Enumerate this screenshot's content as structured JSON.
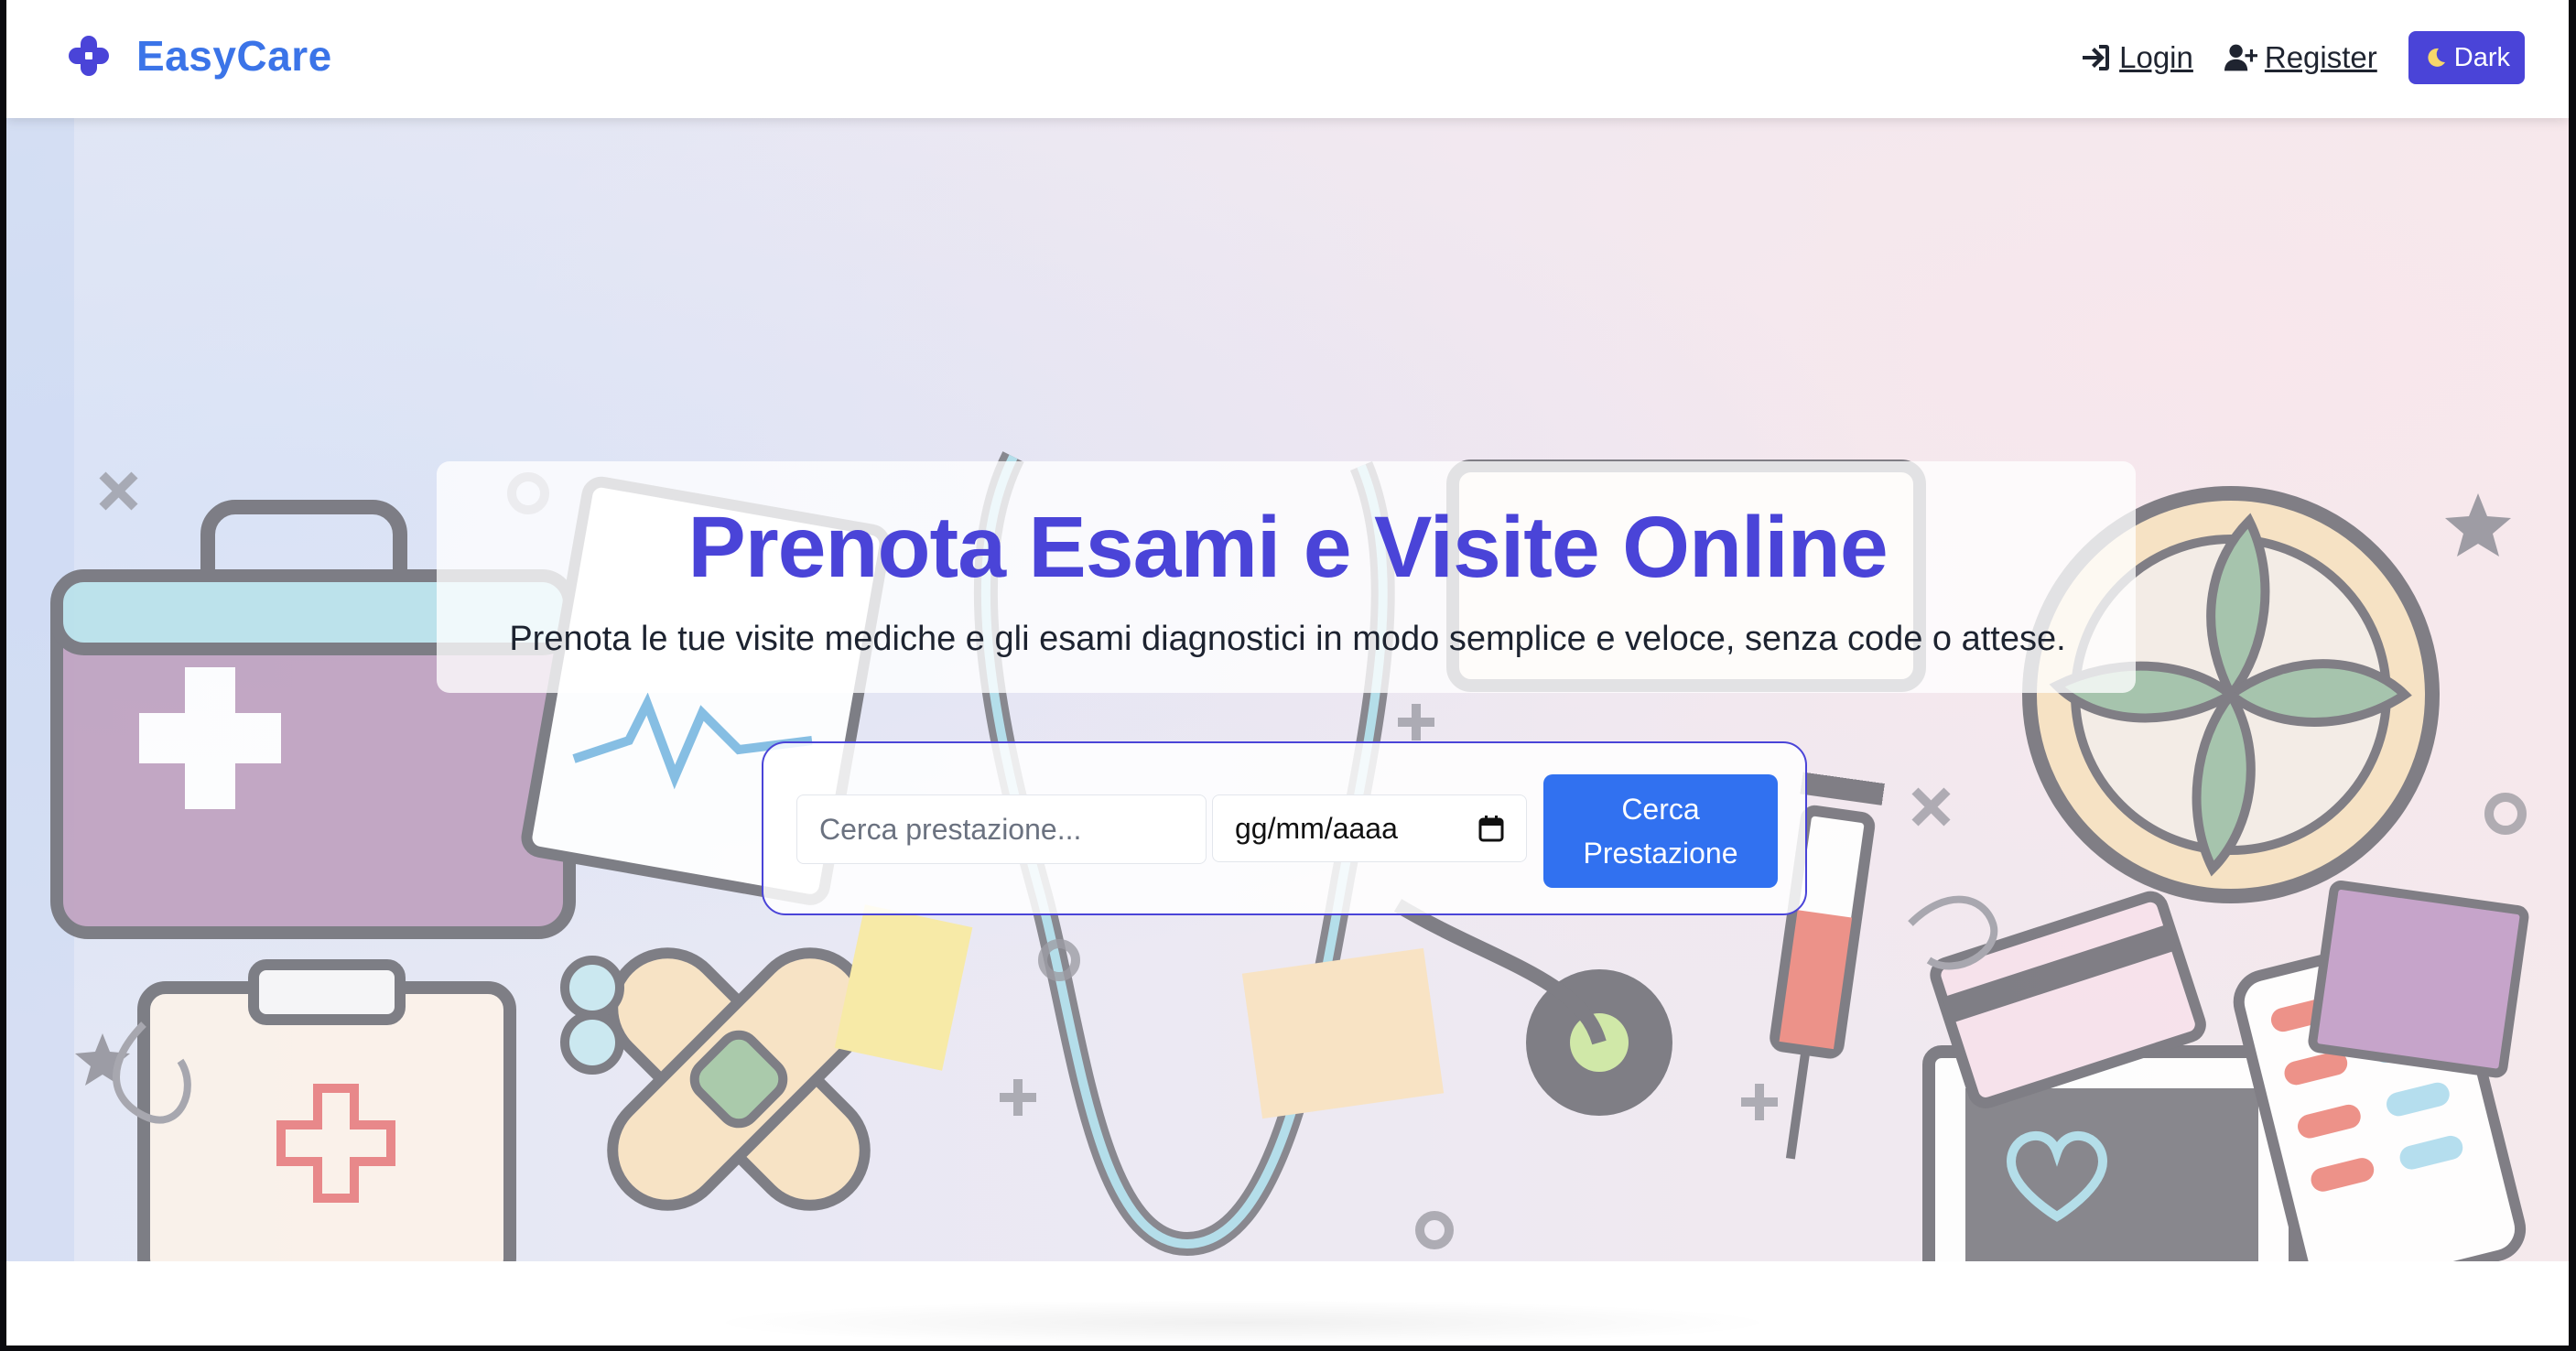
{
  "brand": {
    "name": "EasyCare",
    "icon": "medical-cross-icon",
    "color": "#3b74e8"
  },
  "nav": {
    "login": {
      "label": " Login",
      "icon": "sign-in-icon"
    },
    "register": {
      "label": " Register",
      "icon": "user-plus-icon"
    },
    "theme_toggle": {
      "label": "Dark",
      "icon": "moon-icon",
      "color": "#4a44d8"
    }
  },
  "hero": {
    "title": "Prenota Esami e Visite Online",
    "subtitle": "Prenota le tue visite mediche e gli esami diagnostici in modo semplice e veloce, senza code o attese.",
    "title_color": "#4a44d8",
    "background": "medical-supplies-illustration"
  },
  "search": {
    "placeholder": "Cerca prestazione...",
    "date_placeholder": "gg/mm/aaaa",
    "date_icon": "calendar-icon",
    "button_line1": "Cerca",
    "button_line2": "Prestazione",
    "button_color": "#3171f0"
  }
}
